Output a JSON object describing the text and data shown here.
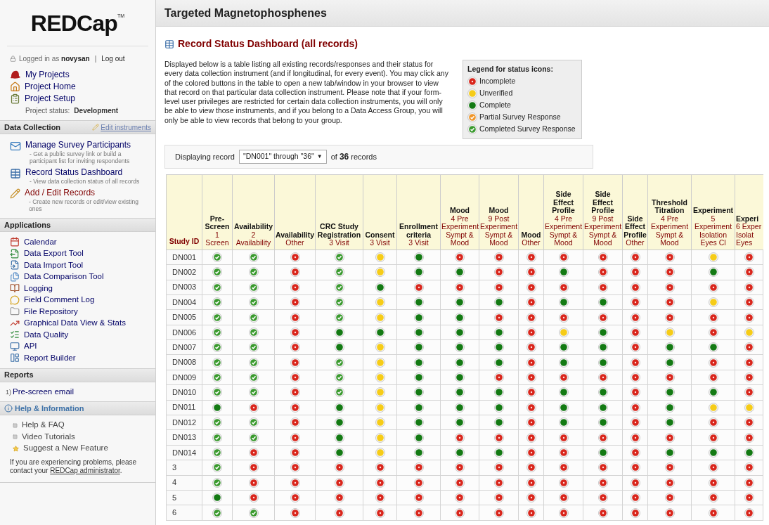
{
  "sidebar": {
    "logo": {
      "name": "REDCap",
      "trademark": "TM"
    },
    "login": {
      "prefix": "Logged in as",
      "user": "novysan",
      "separator": "|",
      "logout": "Log out"
    },
    "top_links": [
      "My Projects",
      "Project Home",
      "Project Setup"
    ],
    "project_status": {
      "label": "Project status:",
      "value": "Development"
    },
    "data_collection": {
      "title": "Data Collection",
      "action": "Edit instruments",
      "items": [
        {
          "label": "Manage Survey Participants",
          "description": "- Get a public survey link or build a participant list for inviting respondents",
          "color": "#000066"
        },
        {
          "label": "Record Status Dashboard",
          "description": "- View data collection status of all records",
          "color": "#000066"
        },
        {
          "label": "Add / Edit Records",
          "description": "- Create new records or edit/view existing ones",
          "color": "#800000"
        }
      ]
    },
    "applications": {
      "title": "Applications",
      "items": [
        "Calendar",
        "Data Export Tool",
        "Data Import Tool",
        "Data Comparison Tool",
        "Logging",
        "Field Comment Log",
        "File Repository",
        "Graphical Data View & Stats",
        "Data Quality",
        "API",
        "Report Builder"
      ]
    },
    "reports": {
      "title": "Reports",
      "items": [
        {
          "number": "1)",
          "label": "Pre-screen email"
        }
      ]
    },
    "help": {
      "title": "Help & Information",
      "items": [
        "Help & FAQ",
        "Video Tutorials",
        "Suggest a New Feature"
      ],
      "note": "If you are experiencing problems, please contact your",
      "note_link": "REDCap administrator",
      "note_end": "."
    }
  },
  "project_title": "Targeted Magnetophosphenes",
  "page_title": "Record Status Dashboard (all records)",
  "description": "Displayed below is a table listing all existing records/responses and their status for every data collection instrument (and if longitudinal, for every event). You may click any of the colored buttons in the table to open a new tab/window in your browser to view that record on that particular data collection instrument. Please note that if your form-level user privileges are restricted for certain data collection instruments, you will only be able to view those instruments, and if you belong to a Data Access Group, you will only be able to view records that belong to your group.",
  "legend": {
    "title": "Legend for status icons:",
    "items": [
      {
        "kind": "incomplete",
        "label": "Incomplete"
      },
      {
        "kind": "unverified",
        "label": "Unverified"
      },
      {
        "kind": "complete",
        "label": "Complete"
      },
      {
        "kind": "partial",
        "label": "Partial Survey Response"
      },
      {
        "kind": "survey_complete",
        "label": "Completed Survey Response"
      }
    ]
  },
  "record_range": {
    "prefix": "Displaying record",
    "value": "\"DN001\" through \"36\"",
    "arrow": "▼",
    "of": "of",
    "count": "36",
    "suffix": "records"
  },
  "table": {
    "id_column": "Study ID",
    "columns": [
      {
        "title": "Pre-Screen",
        "subtitle": "1 Screen"
      },
      {
        "title": "Availability",
        "subtitle": "2 Availability"
      },
      {
        "title": "Availability",
        "subtitle": "Other"
      },
      {
        "title": "CRC Study Registration",
        "subtitle": "3 Visit"
      },
      {
        "title": "Consent",
        "subtitle": "3 Visit"
      },
      {
        "title": "Enrollment criteria",
        "subtitle": "3 Visit"
      },
      {
        "title": "Mood",
        "subtitle": "4 Pre Experiment Sympt & Mood"
      },
      {
        "title": "Mood",
        "subtitle": "9 Post Experiment Sympt & Mood"
      },
      {
        "title": "Mood",
        "subtitle": "Other"
      },
      {
        "title": "Side Effect Profile",
        "subtitle": "4 Pre Experiment Sympt & Mood"
      },
      {
        "title": "Side Effect Profile",
        "subtitle": "9 Post Experiment Sympt & Mood"
      },
      {
        "title": "Side Effect Profile",
        "subtitle": "Other"
      },
      {
        "title": "Threshold Titration",
        "subtitle": "4 Pre Experiment Sympt & Mood"
      },
      {
        "title": "Experiment",
        "subtitle": "5 Experiment Isolation Eyes Cl"
      },
      {
        "title": "Experi",
        "subtitle": "6 Exper Isolat Eyes"
      }
    ],
    "rows": [
      {
        "id": "DN001",
        "statuses": [
          {
            "kind": "survey_complete"
          },
          {
            "kind": "survey_complete"
          },
          {
            "kind": "incomplete"
          },
          {
            "kind": "survey_complete"
          },
          {
            "kind": "unverified"
          },
          {
            "kind": "complete"
          },
          {
            "kind": "incomplete"
          },
          {
            "kind": "incomplete"
          },
          {
            "kind": "incomplete"
          },
          {
            "kind": "incomplete"
          },
          {
            "kind": "incomplete"
          },
          {
            "kind": "incomplete"
          },
          {
            "kind": "incomplete"
          },
          {
            "kind": "unverified"
          },
          {
            "kind": "incomplete"
          }
        ]
      },
      {
        "id": "DN002",
        "statuses": [
          {
            "kind": "survey_complete"
          },
          {
            "kind": "survey_complete"
          },
          {
            "kind": "incomplete"
          },
          {
            "kind": "survey_complete"
          },
          {
            "kind": "unverified"
          },
          {
            "kind": "complete"
          },
          {
            "kind": "complete"
          },
          {
            "kind": "incomplete"
          },
          {
            "kind": "incomplete"
          },
          {
            "kind": "complete"
          },
          {
            "kind": "incomplete"
          },
          {
            "kind": "incomplete"
          },
          {
            "kind": "incomplete"
          },
          {
            "kind": "complete"
          },
          {
            "kind": "incomplete"
          }
        ]
      },
      {
        "id": "DN003",
        "statuses": [
          {
            "kind": "survey_complete"
          },
          {
            "kind": "survey_complete"
          },
          {
            "kind": "incomplete"
          },
          {
            "kind": "survey_complete"
          },
          {
            "kind": "complete"
          },
          {
            "kind": "incomplete"
          },
          {
            "kind": "incomplete"
          },
          {
            "kind": "incomplete"
          },
          {
            "kind": "incomplete"
          },
          {
            "kind": "incomplete"
          },
          {
            "kind": "incomplete"
          },
          {
            "kind": "incomplete"
          },
          {
            "kind": "incomplete"
          },
          {
            "kind": "incomplete"
          },
          {
            "kind": "incomplete"
          }
        ]
      },
      {
        "id": "DN004",
        "statuses": [
          {
            "kind": "survey_complete"
          },
          {
            "kind": "survey_complete"
          },
          {
            "kind": "incomplete"
          },
          {
            "kind": "survey_complete"
          },
          {
            "kind": "unverified"
          },
          {
            "kind": "complete"
          },
          {
            "kind": "complete"
          },
          {
            "kind": "complete"
          },
          {
            "kind": "incomplete"
          },
          {
            "kind": "complete"
          },
          {
            "kind": "complete"
          },
          {
            "kind": "incomplete"
          },
          {
            "kind": "incomplete"
          },
          {
            "kind": "unverified"
          },
          {
            "kind": "incomplete"
          }
        ]
      },
      {
        "id": "DN005",
        "statuses": [
          {
            "kind": "survey_complete"
          },
          {
            "kind": "survey_complete"
          },
          {
            "kind": "incomplete"
          },
          {
            "kind": "survey_complete"
          },
          {
            "kind": "unverified"
          },
          {
            "kind": "complete"
          },
          {
            "kind": "complete"
          },
          {
            "kind": "incomplete"
          },
          {
            "kind": "incomplete"
          },
          {
            "kind": "incomplete"
          },
          {
            "kind": "incomplete"
          },
          {
            "kind": "incomplete"
          },
          {
            "kind": "incomplete"
          },
          {
            "kind": "incomplete"
          },
          {
            "kind": "incomplete"
          }
        ]
      },
      {
        "id": "DN006",
        "statuses": [
          {
            "kind": "survey_complete"
          },
          {
            "kind": "survey_complete"
          },
          {
            "kind": "incomplete"
          },
          {
            "kind": "complete"
          },
          {
            "kind": "complete"
          },
          {
            "kind": "complete"
          },
          {
            "kind": "complete"
          },
          {
            "kind": "complete"
          },
          {
            "kind": "incomplete"
          },
          {
            "kind": "unverified"
          },
          {
            "kind": "complete"
          },
          {
            "kind": "incomplete"
          },
          {
            "kind": "unverified"
          },
          {
            "kind": "incomplete"
          },
          {
            "kind": "unverified"
          }
        ]
      },
      {
        "id": "DN007",
        "statuses": [
          {
            "kind": "survey_complete"
          },
          {
            "kind": "survey_complete"
          },
          {
            "kind": "incomplete"
          },
          {
            "kind": "complete"
          },
          {
            "kind": "unverified"
          },
          {
            "kind": "complete"
          },
          {
            "kind": "complete"
          },
          {
            "kind": "complete"
          },
          {
            "kind": "incomplete"
          },
          {
            "kind": "complete"
          },
          {
            "kind": "complete"
          },
          {
            "kind": "incomplete"
          },
          {
            "kind": "complete"
          },
          {
            "kind": "complete"
          },
          {
            "kind": "incomplete"
          }
        ]
      },
      {
        "id": "DN008",
        "statuses": [
          {
            "kind": "survey_complete"
          },
          {
            "kind": "survey_complete"
          },
          {
            "kind": "incomplete"
          },
          {
            "kind": "survey_complete"
          },
          {
            "kind": "unverified"
          },
          {
            "kind": "complete"
          },
          {
            "kind": "complete"
          },
          {
            "kind": "complete"
          },
          {
            "kind": "incomplete"
          },
          {
            "kind": "complete"
          },
          {
            "kind": "complete"
          },
          {
            "kind": "incomplete"
          },
          {
            "kind": "complete"
          },
          {
            "kind": "incomplete"
          },
          {
            "kind": "incomplete"
          }
        ]
      },
      {
        "id": "DN009",
        "statuses": [
          {
            "kind": "survey_complete"
          },
          {
            "kind": "survey_complete"
          },
          {
            "kind": "incomplete"
          },
          {
            "kind": "survey_complete"
          },
          {
            "kind": "unverified"
          },
          {
            "kind": "complete"
          },
          {
            "kind": "complete"
          },
          {
            "kind": "incomplete"
          },
          {
            "kind": "incomplete"
          },
          {
            "kind": "incomplete"
          },
          {
            "kind": "incomplete"
          },
          {
            "kind": "incomplete"
          },
          {
            "kind": "incomplete"
          },
          {
            "kind": "incomplete"
          },
          {
            "kind": "incomplete"
          }
        ]
      },
      {
        "id": "DN010",
        "statuses": [
          {
            "kind": "survey_complete"
          },
          {
            "kind": "survey_complete"
          },
          {
            "kind": "incomplete"
          },
          {
            "kind": "survey_complete"
          },
          {
            "kind": "unverified"
          },
          {
            "kind": "complete"
          },
          {
            "kind": "complete"
          },
          {
            "kind": "complete"
          },
          {
            "kind": "incomplete"
          },
          {
            "kind": "complete"
          },
          {
            "kind": "complete"
          },
          {
            "kind": "incomplete"
          },
          {
            "kind": "complete"
          },
          {
            "kind": "complete"
          },
          {
            "kind": "incomplete"
          }
        ]
      },
      {
        "id": "DN011",
        "statuses": [
          {
            "kind": "complete"
          },
          {
            "kind": "incomplete"
          },
          {
            "kind": "incomplete"
          },
          {
            "kind": "complete"
          },
          {
            "kind": "unverified"
          },
          {
            "kind": "complete"
          },
          {
            "kind": "complete"
          },
          {
            "kind": "complete"
          },
          {
            "kind": "incomplete"
          },
          {
            "kind": "complete"
          },
          {
            "kind": "complete"
          },
          {
            "kind": "incomplete"
          },
          {
            "kind": "complete"
          },
          {
            "kind": "unverified"
          },
          {
            "kind": "unverified"
          }
        ]
      },
      {
        "id": "DN012",
        "statuses": [
          {
            "kind": "survey_complete"
          },
          {
            "kind": "survey_complete"
          },
          {
            "kind": "incomplete"
          },
          {
            "kind": "complete"
          },
          {
            "kind": "unverified"
          },
          {
            "kind": "complete"
          },
          {
            "kind": "complete"
          },
          {
            "kind": "complete"
          },
          {
            "kind": "incomplete"
          },
          {
            "kind": "complete"
          },
          {
            "kind": "complete"
          },
          {
            "kind": "incomplete"
          },
          {
            "kind": "complete"
          },
          {
            "kind": "incomplete"
          },
          {
            "kind": "incomplete"
          }
        ]
      },
      {
        "id": "DN013",
        "statuses": [
          {
            "kind": "survey_complete"
          },
          {
            "kind": "survey_complete"
          },
          {
            "kind": "incomplete"
          },
          {
            "kind": "complete"
          },
          {
            "kind": "unverified"
          },
          {
            "kind": "complete"
          },
          {
            "kind": "incomplete"
          },
          {
            "kind": "incomplete"
          },
          {
            "kind": "incomplete"
          },
          {
            "kind": "incomplete"
          },
          {
            "kind": "incomplete"
          },
          {
            "kind": "incomplete"
          },
          {
            "kind": "incomplete"
          },
          {
            "kind": "incomplete"
          },
          {
            "kind": "incomplete"
          }
        ]
      },
      {
        "id": "DN014",
        "statuses": [
          {
            "kind": "survey_complete"
          },
          {
            "kind": "incomplete"
          },
          {
            "kind": "incomplete"
          },
          {
            "kind": "complete"
          },
          {
            "kind": "unverified"
          },
          {
            "kind": "complete"
          },
          {
            "kind": "complete"
          },
          {
            "kind": "complete"
          },
          {
            "kind": "incomplete"
          },
          {
            "kind": "incomplete"
          },
          {
            "kind": "complete"
          },
          {
            "kind": "incomplete"
          },
          {
            "kind": "complete"
          },
          {
            "kind": "complete"
          },
          {
            "kind": "complete"
          }
        ]
      },
      {
        "id": "3",
        "statuses": [
          {
            "kind": "survey_complete"
          },
          {
            "kind": "incomplete"
          },
          {
            "kind": "incomplete"
          },
          {
            "kind": "incomplete"
          },
          {
            "kind": "incomplete"
          },
          {
            "kind": "incomplete"
          },
          {
            "kind": "incomplete"
          },
          {
            "kind": "incomplete"
          },
          {
            "kind": "incomplete"
          },
          {
            "kind": "incomplete"
          },
          {
            "kind": "incomplete"
          },
          {
            "kind": "incomplete"
          },
          {
            "kind": "incomplete"
          },
          {
            "kind": "incomplete"
          },
          {
            "kind": "incomplete"
          }
        ]
      },
      {
        "id": "4",
        "statuses": [
          {
            "kind": "survey_complete"
          },
          {
            "kind": "incomplete"
          },
          {
            "kind": "incomplete"
          },
          {
            "kind": "incomplete"
          },
          {
            "kind": "incomplete"
          },
          {
            "kind": "incomplete"
          },
          {
            "kind": "incomplete"
          },
          {
            "kind": "incomplete"
          },
          {
            "kind": "incomplete"
          },
          {
            "kind": "incomplete"
          },
          {
            "kind": "incomplete"
          },
          {
            "kind": "incomplete"
          },
          {
            "kind": "incomplete"
          },
          {
            "kind": "incomplete"
          },
          {
            "kind": "incomplete"
          }
        ]
      },
      {
        "id": "5",
        "statuses": [
          {
            "kind": "complete"
          },
          {
            "kind": "incomplete"
          },
          {
            "kind": "incomplete"
          },
          {
            "kind": "incomplete"
          },
          {
            "kind": "incomplete"
          },
          {
            "kind": "incomplete"
          },
          {
            "kind": "incomplete"
          },
          {
            "kind": "incomplete"
          },
          {
            "kind": "incomplete"
          },
          {
            "kind": "incomplete"
          },
          {
            "kind": "incomplete"
          },
          {
            "kind": "incomplete"
          },
          {
            "kind": "incomplete"
          },
          {
            "kind": "incomplete"
          },
          {
            "kind": "incomplete"
          }
        ]
      },
      {
        "id": "6",
        "statuses": [
          {
            "kind": "survey_complete"
          },
          {
            "kind": "survey_complete"
          },
          {
            "kind": "incomplete"
          },
          {
            "kind": "incomplete"
          },
          {
            "kind": "incomplete"
          },
          {
            "kind": "incomplete"
          },
          {
            "kind": "incomplete"
          },
          {
            "kind": "incomplete"
          },
          {
            "kind": "incomplete"
          },
          {
            "kind": "incomplete"
          },
          {
            "kind": "incomplete"
          },
          {
            "kind": "incomplete"
          },
          {
            "kind": "incomplete"
          },
          {
            "kind": "incomplete"
          },
          {
            "kind": "incomplete"
          }
        ]
      }
    ]
  }
}
